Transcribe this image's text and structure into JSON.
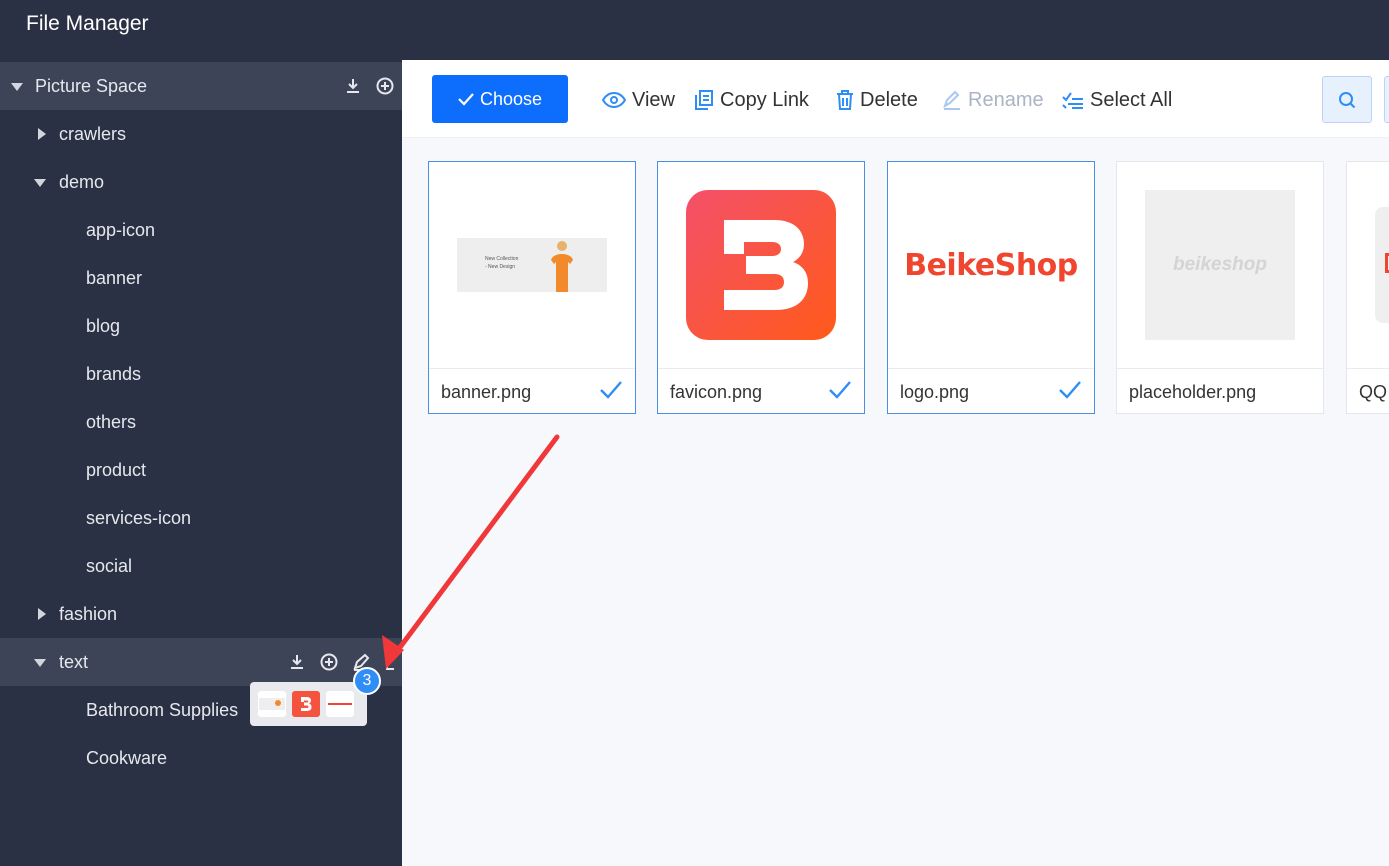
{
  "app": {
    "title": "File Manager"
  },
  "sidebar": {
    "root": {
      "label": "Picture Space"
    },
    "items": [
      {
        "label": "crawlers"
      },
      {
        "label": "demo"
      },
      {
        "label": "app-icon"
      },
      {
        "label": "banner"
      },
      {
        "label": "blog"
      },
      {
        "label": "brands"
      },
      {
        "label": "others"
      },
      {
        "label": "product"
      },
      {
        "label": "services-icon"
      },
      {
        "label": "social"
      },
      {
        "label": "fashion"
      },
      {
        "label": "text"
      },
      {
        "label": "Bathroom Supplies"
      },
      {
        "label": "Cookware"
      }
    ]
  },
  "toolbar": {
    "choose_label": "Choose",
    "view_label": "View",
    "copy_link_label": "Copy Link",
    "delete_label": "Delete",
    "rename_label": "Rename",
    "select_all_label": "Select All"
  },
  "files": [
    {
      "name": "banner.png",
      "selected": true
    },
    {
      "name": "favicon.png",
      "selected": true
    },
    {
      "name": "logo.png",
      "selected": true
    },
    {
      "name": "placeholder.png",
      "selected": false
    },
    {
      "name": "QQ",
      "selected": false
    }
  ],
  "thumbs": {
    "banner_line1": "New Collection",
    "banner_line2": "- New Design",
    "logo_text": "BeikeShop",
    "placeholder_text": "beikeshop"
  },
  "drag": {
    "count": "3"
  },
  "colors": {
    "primary": "#0d6efd",
    "sidebar_bg": "#2b3144",
    "arrow": "#f0383a"
  }
}
